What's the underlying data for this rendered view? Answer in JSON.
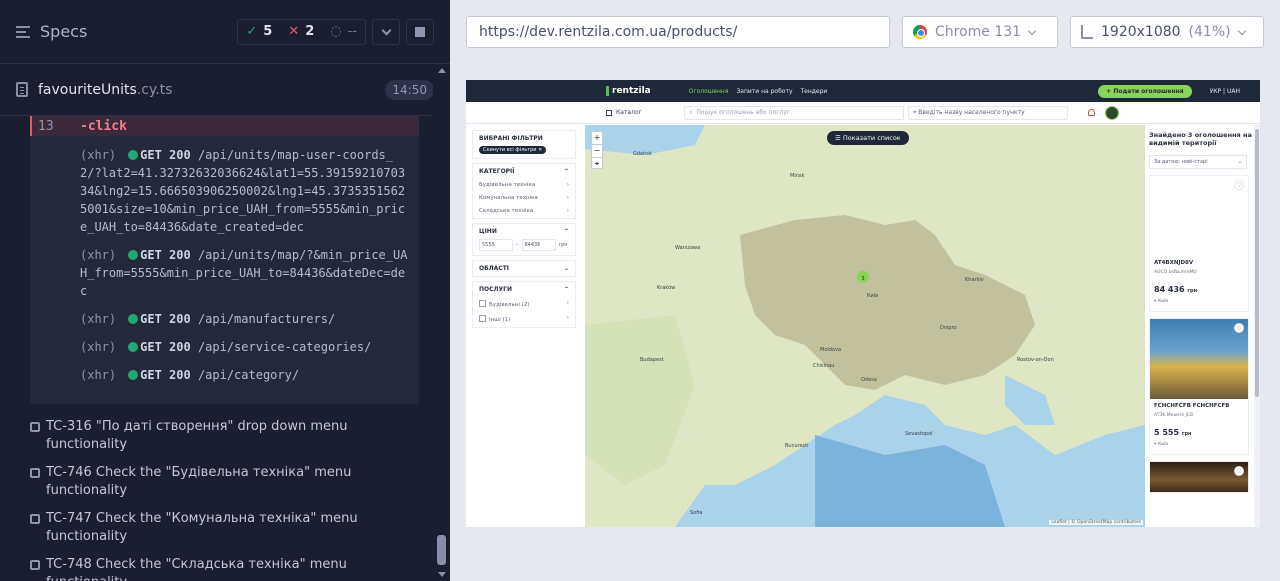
{
  "runner": {
    "title": "Specs",
    "passed": "5",
    "failed": "2",
    "pending": "--",
    "file_name": "favouriteUnits",
    "file_ext": ".cy.ts",
    "duration": "14:50",
    "command_line_no": "13",
    "command": "-click",
    "xhr_entries": [
      {
        "kind": "(xhr)",
        "method": "GET 200",
        "path": "/api/units/map-user-coords_2/?lat2=41.32732632036624&lat1=55.3915921070334&lng2=15.666503906250002&lng1=45.37353515625001&size=10&min_price_UAH_from=5555&min_price_UAH_to=84436&date_created=dec"
      },
      {
        "kind": "(xhr)",
        "method": "GET 200",
        "path": "/api/units/map/?&min_price_UAH_from=5555&min_price_UAH_to=84436&dateDec=dec"
      },
      {
        "kind": "(xhr)",
        "method": "GET 200",
        "path": "/api/manufacturers/"
      },
      {
        "kind": "(xhr)",
        "method": "GET 200",
        "path": "/api/service-categories/"
      },
      {
        "kind": "(xhr)",
        "method": "GET 200",
        "path": "/api/category/"
      }
    ],
    "tests": [
      "TC-316 \"По даті створення\" drop down menu functionality",
      "TC-746 Check the \"Будівельна техніка\" menu functionality",
      "TC-747 Check the \"Комунальна техніка\" menu functionality",
      "TC-748 Check the \"Складська техніка\" menu functionality"
    ]
  },
  "browser": {
    "url": "https://dev.rentzila.com.ua/products/",
    "name": "Chrome 131",
    "viewport": "1920x1080",
    "scale": "(41%)"
  },
  "app": {
    "logo": "rentzila",
    "nav": [
      "Оголошення",
      "Запити на роботу",
      "Тендери"
    ],
    "post_button": "Подати оголошення",
    "lang": "УКР | UAH",
    "catalog": "Каталог",
    "search_placeholder": "Пошук оголошень або послуг",
    "location_placeholder": "Введіть назву населеного пункту",
    "filters": {
      "selected_title": "ВИБРАНІ ФІЛЬТРИ",
      "reset_chip": "Скинути всі фільтри",
      "categories_title": "КАТЕГОРІЇ",
      "categories": [
        "Будівельна техніка",
        "Комунальна техніка",
        "Складська техніка"
      ],
      "prices_title": "ЦІНИ",
      "price_from": "5555",
      "price_to": "84436",
      "currency": "грн",
      "regions_title": "ОБЛАСТІ",
      "services_title": "ПОСЛУГИ",
      "services": [
        "Будівельні (2)",
        "Інші (1)"
      ]
    },
    "map": {
      "show_list": "Показати список",
      "cluster": "3",
      "attribution": "Leaflet | © OpenStreetMap contributors",
      "cities": [
        {
          "name": "Gdańsk"
        },
        {
          "name": "Warszawa"
        },
        {
          "name": "Kraków"
        },
        {
          "name": "Budapest"
        },
        {
          "name": "Minsk"
        },
        {
          "name": "Київ"
        },
        {
          "name": "Kharkiv"
        },
        {
          "name": "Odesa"
        },
        {
          "name": "Rostov-on-Don"
        },
        {
          "name": "București"
        },
        {
          "name": "Sevastopol"
        },
        {
          "name": "Moldova"
        },
        {
          "name": "Chisinau"
        },
        {
          "name": "Sofia"
        },
        {
          "name": "Dnipro"
        }
      ]
    },
    "results": {
      "found": "Знайдено 3 оголошення на видимій території",
      "sort": "За датою: нові-старі",
      "cards": [
        {
          "id": "AT4BXNJD8V",
          "sub": "AGCO bsfbLmmMU",
          "price": "84 436",
          "currency": "грн",
          "city": "Київ"
        },
        {
          "id": "FCHCHFCFB FCHCHFCFB",
          "sub": "AT3K Mowerz JCB",
          "price": "5 555",
          "currency": "грн",
          "city": "Київ"
        }
      ]
    }
  }
}
